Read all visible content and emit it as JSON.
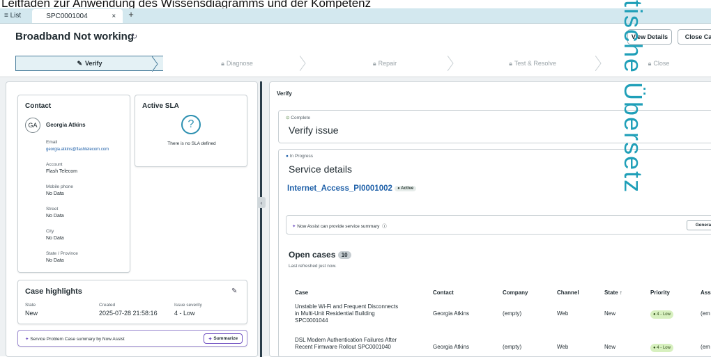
{
  "banner": {
    "text": "Leitfaden zur Anwendung des Wissensdiagramms und der Kompetenz"
  },
  "tabs": {
    "list_label": "≡ List",
    "active_label": "SPC0001004",
    "close_glyph": "×",
    "add_glyph": "+"
  },
  "header": {
    "title": "Broadband Not working",
    "view_details": "View Details",
    "close_case": "Close Ca"
  },
  "stepper": {
    "steps": [
      "Verify",
      "Diagnose",
      "Repair",
      "Test & Resolve",
      "Close"
    ]
  },
  "contact": {
    "heading": "Contact",
    "initials": "GA",
    "name": "Georgia Atkins",
    "email_label": "Email",
    "email": "georgia.atkins@flashtelecom.com",
    "account_label": "Account",
    "account": "Flash Telecom",
    "mobile_label": "Mobile phone",
    "mobile": "No Data",
    "street_label": "Street",
    "street": "No Data",
    "city_label": "City",
    "city": "No Data",
    "state_label": "State / Province",
    "state": "No Data"
  },
  "sla": {
    "heading": "Active SLA",
    "message": "There is no SLA defined"
  },
  "highlights": {
    "heading": "Case highlights",
    "state_label": "State",
    "state": "New",
    "created_label": "Created",
    "created": "2025-07-28 21:58:16",
    "severity_label": "Issue severity",
    "severity": "4 - Low"
  },
  "now_assist_left": {
    "text": "Service Problem Case summary by Now Assist",
    "button": "Summarize"
  },
  "verify": {
    "section": "Verify",
    "complete_status": "Complete",
    "complete_title": "Verify issue",
    "progress_status": "In Progress",
    "progress_title": "Service details",
    "service_link": "Internet_Access_PI0001002",
    "service_badge": "Active",
    "assist_text": "Now Assist can provide service summary",
    "assist_button": "Generat"
  },
  "open_cases": {
    "title": "Open cases",
    "count": "10",
    "refreshed": "Last refreshed just now.",
    "columns": [
      "Case",
      "Contact",
      "Company",
      "Channel",
      "State",
      "Priority",
      "Ass"
    ],
    "rows": [
      {
        "case": "Unstable Wi-Fi and Frequent Disconnects in Multi-Unit Residential Building SPC0001044",
        "contact": "Georgia Atkins",
        "company": "(empty)",
        "channel": "Web",
        "state": "New",
        "priority": "4 - Low",
        "assigned": "(em"
      },
      {
        "case": "DSL Modem Authentication Failures After Recent Firmware Rollout SPC0001040",
        "contact": "Georgia Atkins",
        "company": "(empty)",
        "channel": "Web",
        "state": "New",
        "priority": "4 - Low",
        "assigned": "(em"
      }
    ]
  },
  "overlay": {
    "text": "tische Übersetz"
  },
  "colors": {
    "accent": "#1d5fa8",
    "tabbar": "#d3e8ef",
    "overlay": "#1f9fb8"
  }
}
